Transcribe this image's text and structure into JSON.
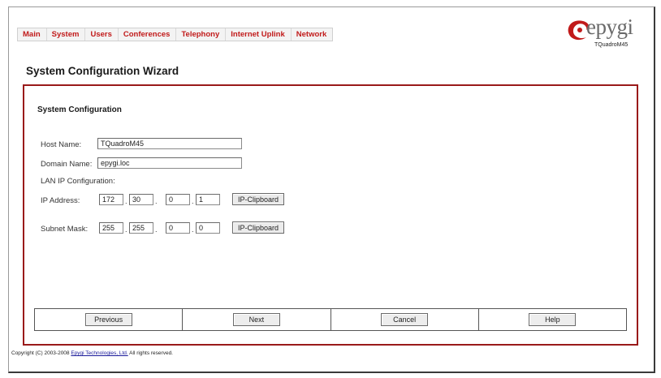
{
  "nav": {
    "items": [
      "Main",
      "System",
      "Users",
      "Conferences",
      "Telephony",
      "Internet Uplink",
      "Network"
    ]
  },
  "brand": {
    "logo_text": "epygi",
    "model": "TQuadroM45",
    "accent_color": "#c11a1a"
  },
  "page": {
    "title": "System Configuration Wizard"
  },
  "form": {
    "section_title": "System Configuration",
    "host_name_label": "Host Name:",
    "host_name_value": "TQuadroM45",
    "domain_name_label": "Domain Name:",
    "domain_name_value": "epygi.loc",
    "lan_label": "LAN IP Configuration:",
    "ip_label": "IP Address:",
    "ip_octets": [
      "172",
      "30",
      "0",
      "1"
    ],
    "subnet_label": "Subnet Mask:",
    "subnet_octets": [
      "255",
      "255",
      "0",
      "0"
    ],
    "clipboard_label": "IP-Clipboard"
  },
  "buttons": {
    "previous": "Previous",
    "next": "Next",
    "cancel": "Cancel",
    "help": "Help"
  },
  "footer": {
    "prefix": "Copyright (C) 2003-2008 ",
    "link": "Epygi Technologies, Ltd.",
    "suffix": " All rights reserved."
  }
}
